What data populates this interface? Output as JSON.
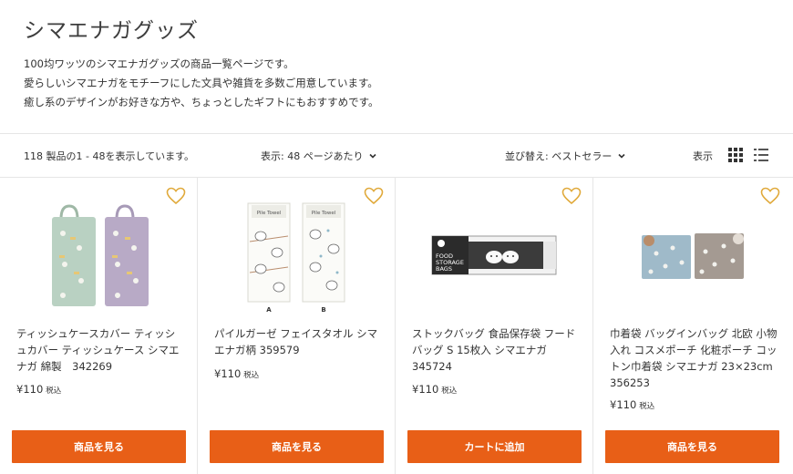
{
  "header": {
    "title": "シマエナガグッズ",
    "description": [
      "100均ワッツのシマエナガグッズの商品一覧ページです。",
      "愛らしいシマエナガをモチーフにした文具や雑貨を多数ご用意しています。",
      "癒し系のデザインがお好きな方や、ちょっとしたギフトにもおすすめです。"
    ]
  },
  "toolbar": {
    "count_text": "118 製品の1 - 48を表示しています。",
    "per_page_text": "表示: 48 ページあたり",
    "sort_text": "並び替え: ベストセラー",
    "view_label": "表示"
  },
  "products": [
    {
      "name": "ティッシュケースカバー ティッシュカバー ティッシュケース シマエナガ 綿製　342269",
      "price": "¥110",
      "tax": "税込",
      "button": "商品を見る"
    },
    {
      "name": "パイルガーゼ フェイスタオル シマエナガ柄 359579",
      "price": "¥110",
      "tax": "税込",
      "button": "商品を見る",
      "image_labels": [
        "Pile Towel",
        "A",
        "B"
      ]
    },
    {
      "name": "ストックバッグ 食品保存袋 フードバッグ S 15枚入 シマエナガ　345724",
      "price": "¥110",
      "tax": "税込",
      "button": "カートに追加",
      "image_labels": [
        "FOOD",
        "STORAGE",
        "BAGS"
      ]
    },
    {
      "name": "巾着袋 バッグインバッグ 北欧 小物入れ コスメポーチ 化粧ポーチ コットン巾着袋 シマエナガ 23×23cm　356253",
      "price": "¥110",
      "tax": "税込",
      "button": "商品を見る"
    }
  ],
  "colors": {
    "accent": "#e85f17",
    "heart": "#e0a93a",
    "border": "#e6e6e6"
  },
  "icons": [
    "chevron-down-icon",
    "grid-view-icon",
    "list-view-icon",
    "heart-icon"
  ]
}
